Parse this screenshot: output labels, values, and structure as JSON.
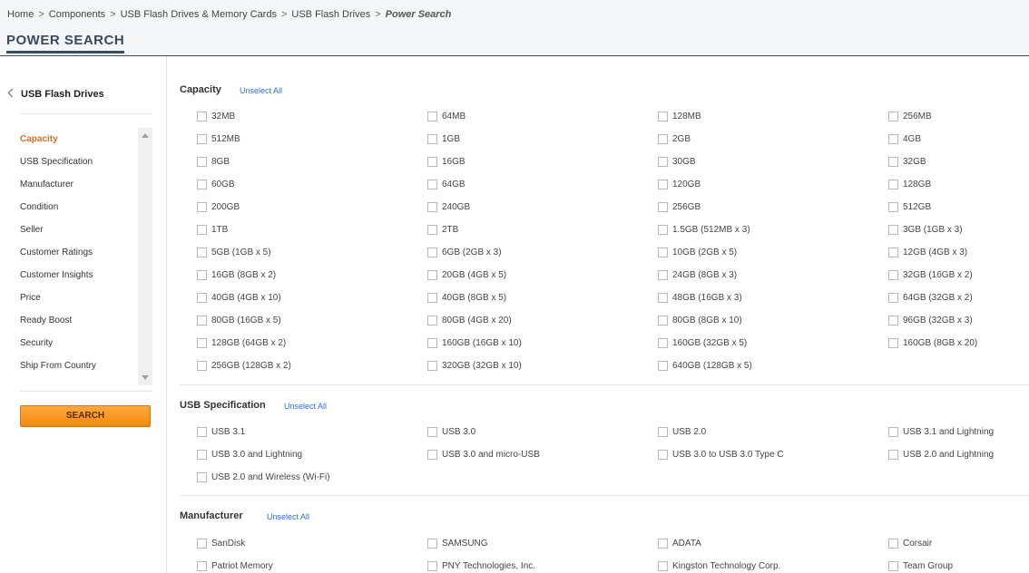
{
  "breadcrumb": [
    "Home",
    "Components",
    "USB Flash Drives & Memory Cards",
    "USB Flash Drives",
    "Power Search"
  ],
  "breadcrumb_sep": ">",
  "page_title": "POWER SEARCH",
  "sidebar": {
    "title": "USB Flash Drives",
    "items": [
      "Capacity",
      "USB Specification",
      "Manufacturer",
      "Condition",
      "Seller",
      "Customer Ratings",
      "Customer Insights",
      "Price",
      "Ready Boost",
      "Security",
      "Ship From Country"
    ],
    "active": "Capacity",
    "search_label": "SEARCH"
  },
  "sections": [
    {
      "title": "Capacity",
      "unselect_label": "Unselect All",
      "options": [
        "32MB",
        "64MB",
        "128MB",
        "256MB",
        "512MB",
        "1GB",
        "2GB",
        "4GB",
        "8GB",
        "16GB",
        "30GB",
        "32GB",
        "60GB",
        "64GB",
        "120GB",
        "128GB",
        "200GB",
        "240GB",
        "256GB",
        "512GB",
        "1TB",
        "2TB",
        "1.5GB (512MB x 3)",
        "3GB (1GB x 3)",
        "5GB (1GB x 5)",
        "6GB (2GB x 3)",
        "10GB (2GB x 5)",
        "12GB (4GB x 3)",
        "16GB (8GB x 2)",
        "20GB (4GB x 5)",
        "24GB (8GB x 3)",
        "32GB (16GB x 2)",
        "40GB (4GB x 10)",
        "40GB (8GB x 5)",
        "48GB (16GB x 3)",
        "64GB (32GB x 2)",
        "80GB (16GB x 5)",
        "80GB (4GB x 20)",
        "80GB (8GB x 10)",
        "96GB (32GB x 3)",
        "128GB (64GB x 2)",
        "160GB (16GB x 10)",
        "160GB (32GB x 5)",
        "160GB (8GB x 20)",
        "256GB (128GB x 2)",
        "320GB (32GB x 10)",
        "640GB (128GB x 5)"
      ]
    },
    {
      "title": "USB Specification",
      "unselect_label": "Unselect All",
      "options": [
        "USB 3.1",
        "USB 3.0",
        "USB 2.0",
        "USB 3.1 and Lightning",
        "USB 3.0 and Lightning",
        "USB 3.0 and micro-USB",
        "USB 3.0 to USB 3.0 Type C",
        "USB 2.0 and Lightning",
        "USB 2.0 and Wireless (Wi-Fi)"
      ]
    },
    {
      "title": "Manufacturer",
      "unselect_label": "Unselect All",
      "options": [
        "SanDisk",
        "SAMSUNG",
        "ADATA",
        "Corsair",
        "Patriot Memory",
        "PNY Technologies, Inc.",
        "Kingston Technology Corp.",
        "Team Group"
      ]
    }
  ],
  "colors": {
    "accent": "#e06c1a",
    "link": "#2f6fd6",
    "header_navy": "#3b4a5e",
    "button": "#f7941d"
  },
  "icons": {
    "back": "chevron-left-icon",
    "scroll_up": "arrow-up-icon",
    "scroll_down": "arrow-down-icon",
    "checkbox": "checkbox-icon"
  }
}
